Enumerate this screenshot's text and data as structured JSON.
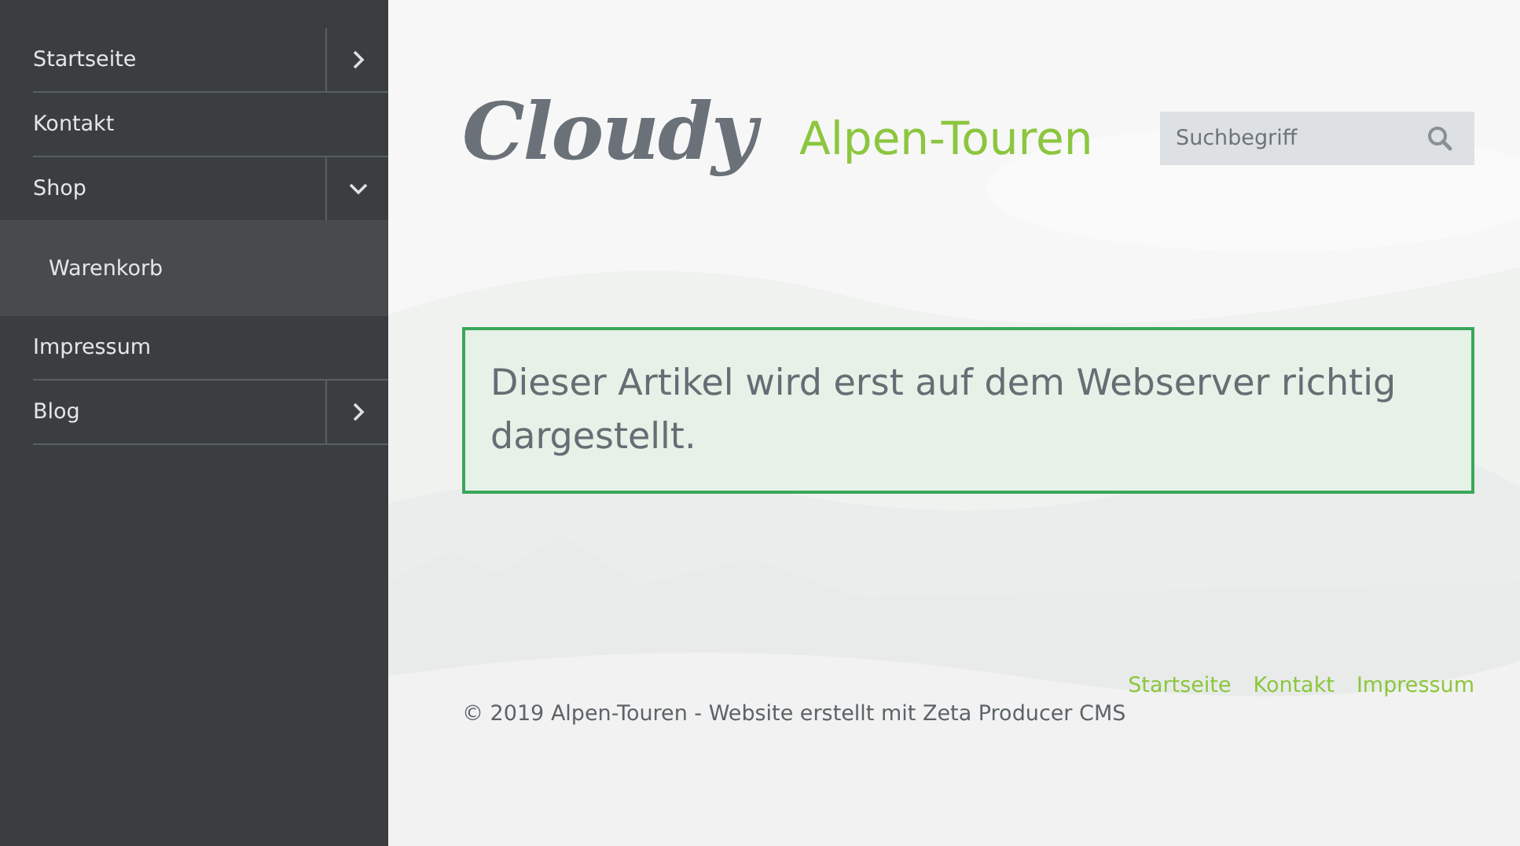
{
  "sidebar": {
    "items": [
      {
        "label": "Startseite",
        "expanded": false
      },
      {
        "label": "Kontakt"
      },
      {
        "label": "Shop",
        "expanded": true,
        "children": [
          {
            "label": "Warenkorb"
          }
        ]
      },
      {
        "label": "Impressum"
      },
      {
        "label": "Blog",
        "expanded": false
      }
    ]
  },
  "header": {
    "logo": "Cloudy",
    "site_title": "Alpen-Touren",
    "search": {
      "placeholder": "Suchbegriff"
    }
  },
  "notice": "Dieser Artikel wird erst auf dem Webserver richtig dargestellt.",
  "footer": {
    "links": [
      "Startseite",
      "Kontakt",
      "Impressum"
    ],
    "copyright": "© 2019 Alpen-Touren - Website erstellt mit Zeta Producer CMS"
  }
}
